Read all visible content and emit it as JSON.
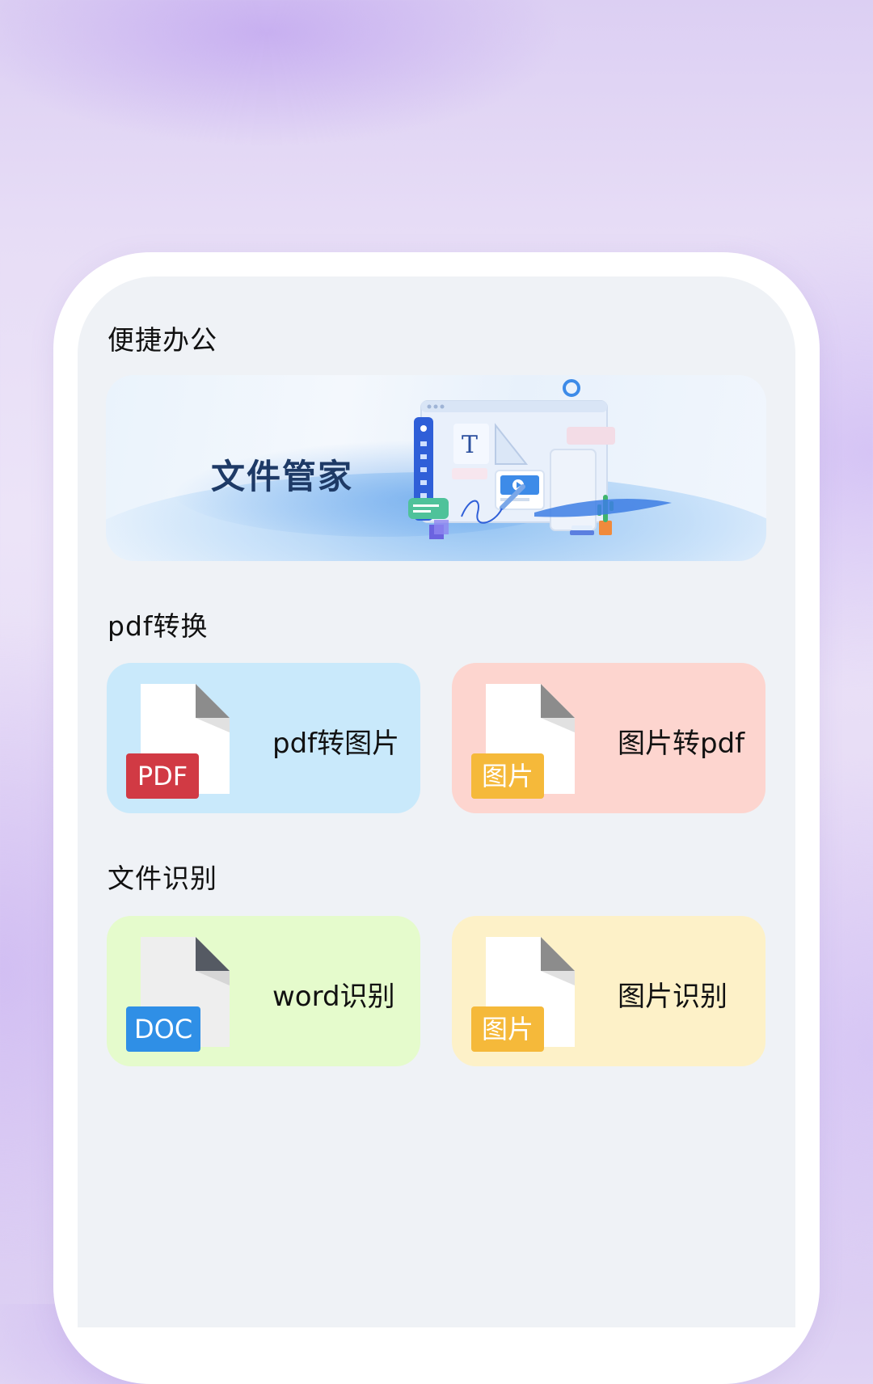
{
  "sections": {
    "office": {
      "title": "便捷办公",
      "banner_title": "文件管家"
    },
    "pdf": {
      "title": "pdf转换",
      "cards": [
        {
          "label": "pdf转图片",
          "badge": "PDF",
          "bg": "#c9e9fb",
          "badge_color": "#d13a44"
        },
        {
          "label": "图片转pdf",
          "badge": "图片",
          "bg": "#fdd5cf",
          "badge_color": "#f5b93a"
        }
      ]
    },
    "recognize": {
      "title": "文件识别",
      "cards": [
        {
          "label": "word识别",
          "badge": "DOC",
          "bg": "#e5fbcc",
          "badge_color": "#2f8fe6"
        },
        {
          "label": "图片识别",
          "badge": "图片",
          "bg": "#fdf1c8",
          "badge_color": "#f5b93a"
        }
      ]
    }
  },
  "icons": {
    "banner_illustration": "document-editor-illustration",
    "file": "file-icon"
  }
}
